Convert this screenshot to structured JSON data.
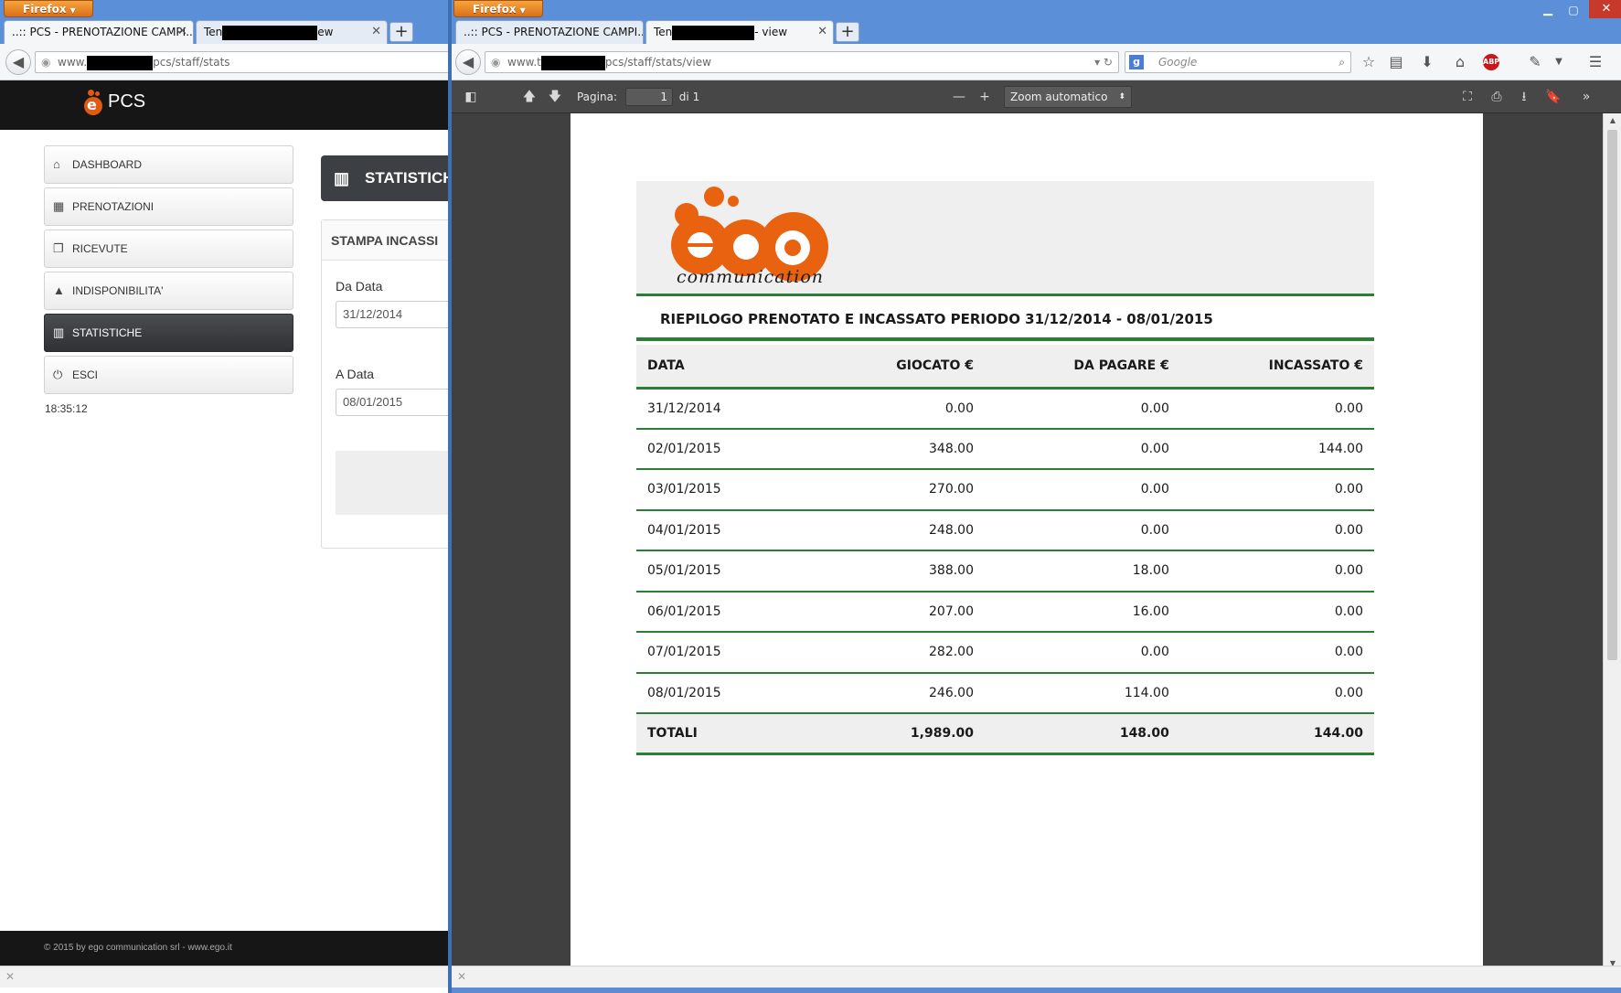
{
  "left_window": {
    "firefox_label": "Firefox",
    "tabs": [
      {
        "title": "..:: PCS - PRENOTAZIONE CAMPI...",
        "active": true
      },
      {
        "title_prefix": "Ten",
        "title_suffix": "ew",
        "active": false
      }
    ],
    "url_prefix": "www.",
    "url_suffix": "pcs/staff/stats",
    "site_title": "PCS",
    "menu": [
      {
        "label": "DASHBOARD",
        "icon": "home-icon",
        "active": false
      },
      {
        "label": "PRENOTAZIONI",
        "icon": "calendar-icon",
        "active": false
      },
      {
        "label": "RICEVUTE",
        "icon": "copy-icon",
        "active": false
      },
      {
        "label": "INDISPONIBILITA'",
        "icon": "warning-icon",
        "active": false
      },
      {
        "label": "STATISTICHE",
        "icon": "bar-chart-icon",
        "active": true
      },
      {
        "label": "ESCI",
        "icon": "power-icon",
        "active": false
      }
    ],
    "clock": "18:35:12",
    "panel_title": "STATISTICHE",
    "form_title": "STAMPA INCASSI",
    "da_data_label": "Da Data",
    "da_data_value": "31/12/2014",
    "a_data_label": "A Data",
    "a_data_value": "08/01/2015",
    "footer": "© 2015 by ego communication srl - www.ego.it"
  },
  "right_window": {
    "firefox_label": "Firefox",
    "tabs": [
      {
        "title": "..:: PCS - PRENOTAZIONE CAMPI...",
        "active": false
      },
      {
        "title_prefix": "Ten",
        "title_suffix": "- view",
        "active": true
      }
    ],
    "url_prefix": "www.t",
    "url_suffix": "pcs/staff/stats/view",
    "search_placeholder": "Google",
    "pdf_toolbar": {
      "page_label": "Pagina:",
      "page_value": "1",
      "page_total": "di 1",
      "zoom": "Zoom automatico"
    },
    "report": {
      "brand_text": "communication",
      "title": "RIEPILOGO PRENOTATO E INCASSATO PERIODO 31/12/2014 - 08/01/2015",
      "columns": [
        "DATA",
        "GIOCATO €",
        "DA PAGARE €",
        "INCASSATO €"
      ],
      "rows": [
        [
          "31/12/2014",
          "0.00",
          "0.00",
          "0.00"
        ],
        [
          "02/01/2015",
          "348.00",
          "0.00",
          "144.00"
        ],
        [
          "03/01/2015",
          "270.00",
          "0.00",
          "0.00"
        ],
        [
          "04/01/2015",
          "248.00",
          "0.00",
          "0.00"
        ],
        [
          "05/01/2015",
          "388.00",
          "18.00",
          "0.00"
        ],
        [
          "06/01/2015",
          "207.00",
          "16.00",
          "0.00"
        ],
        [
          "07/01/2015",
          "282.00",
          "0.00",
          "0.00"
        ],
        [
          "08/01/2015",
          "246.00",
          "114.00",
          "0.00"
        ]
      ],
      "totals": [
        "TOTALI",
        "1,989.00",
        "148.00",
        "144.00"
      ]
    }
  },
  "colors": {
    "accent_green": "#2a7f34",
    "brand_orange": "#e8620f",
    "firefox_orange": "#e8801f",
    "titlebar_blue": "#5b8fd7"
  }
}
